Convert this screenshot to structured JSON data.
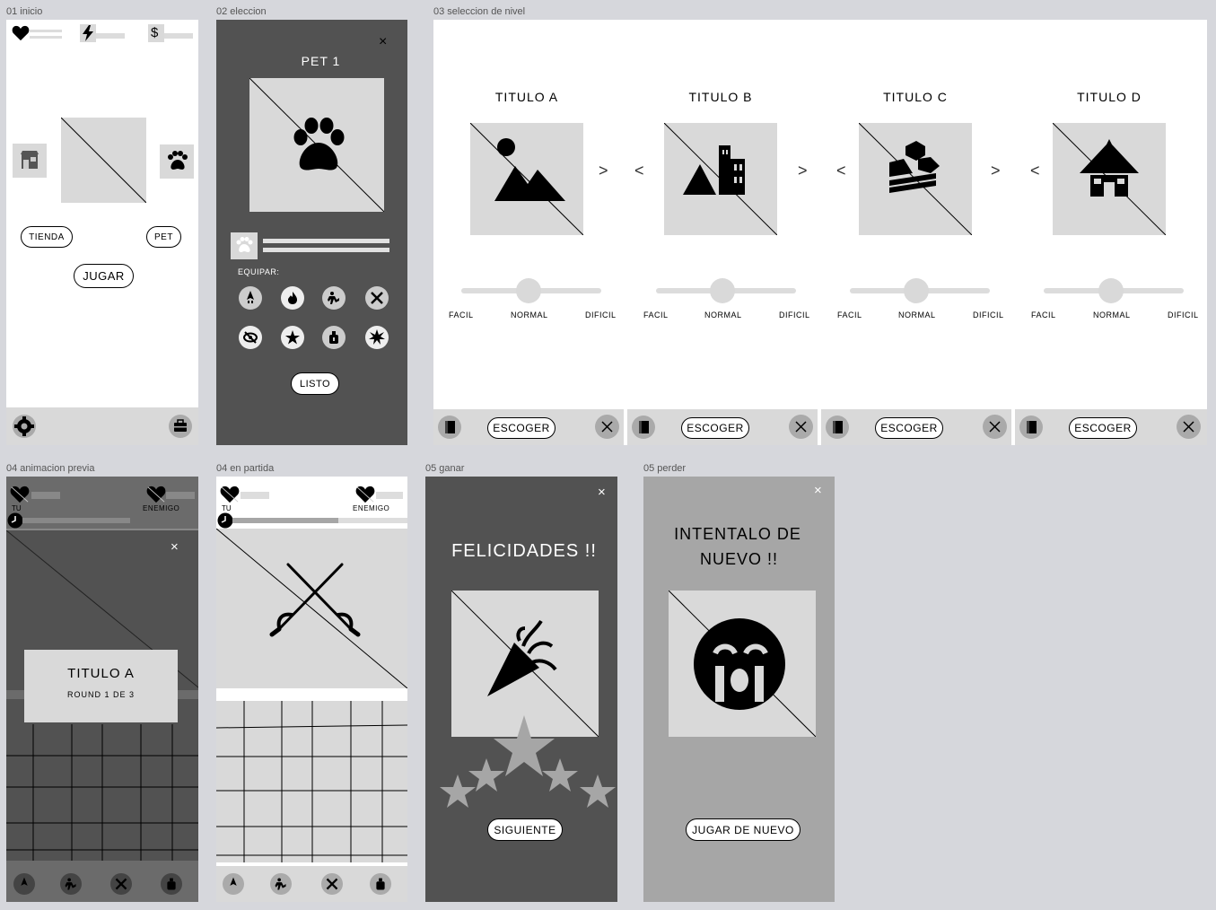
{
  "frames": {
    "inicio": "01 inicio",
    "eleccion": "02 eleccion",
    "seleccion": "03 seleccion de nivel",
    "animacion": "04 animacion previa",
    "partida": "04 en partida",
    "ganar": "05 ganar",
    "perder": "05 perder"
  },
  "inicio": {
    "currency_symbol": "$",
    "tienda_label": "TIENDA",
    "pet_label": "PET",
    "jugar_label": "JUGAR"
  },
  "eleccion": {
    "close": "×",
    "title": "PET 1",
    "equipar_label": "EQUIPAR:",
    "listo_label": "LISTO"
  },
  "seleccion": {
    "levels": [
      {
        "title": "TITULO A",
        "icon": "mountain-icon"
      },
      {
        "title": "TITULO B",
        "icon": "city-icon"
      },
      {
        "title": "TITULO C",
        "icon": "landscape-icon"
      },
      {
        "title": "TITULO D",
        "icon": "hut-icon"
      }
    ],
    "difficulty": [
      "FACIL",
      "NORMAL",
      "DIFICIL"
    ],
    "difficulty_value": "NORMAL",
    "escoger_label": "ESCOGER",
    "next_arrow": ">",
    "prev_arrow": "<"
  },
  "animacion": {
    "tu_label": "TU",
    "enemigo_label": "ENEMIGO",
    "close": "×",
    "card_title": "TITULO A",
    "round_text": "ROUND  1  DE 3"
  },
  "partida": {
    "tu_label": "TU",
    "enemigo_label": "ENEMIGO"
  },
  "ganar": {
    "close": "×",
    "title": "FELICIDADES !!",
    "button": "SIGUIENTE"
  },
  "perder": {
    "close": "×",
    "title_line1": "INTENTALO DE",
    "title_line2": "NUEVO !!",
    "button": "JUGAR DE  NUEVO"
  },
  "colors": {
    "dark_gray": "#525252",
    "mid_gray": "#a6a6a6",
    "placeholder": "#d9d9d9",
    "canvas": "#d6d7dc"
  }
}
